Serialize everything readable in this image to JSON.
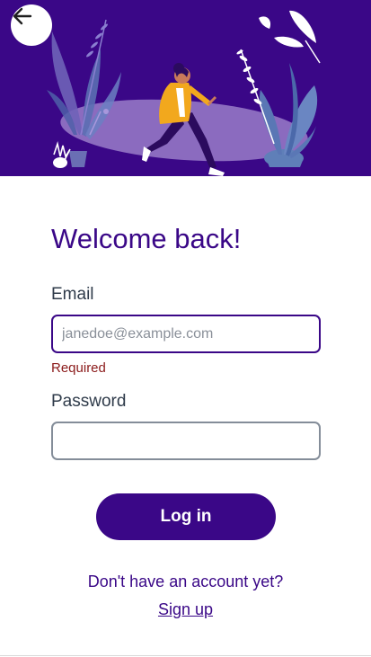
{
  "header": {
    "back_button_icon": "arrow-left-icon",
    "illustration": "woman-walking-with-plants-illustration",
    "background_color": "#3a0787"
  },
  "form": {
    "title": "Welcome back!",
    "email_label": "Email",
    "email_placeholder": "janedoe@example.com",
    "email_value": "",
    "email_error": "Required",
    "password_label": "Password",
    "password_value": "",
    "submit_label": "Log in"
  },
  "footer": {
    "prompt": "Don't have an account yet?",
    "signup_link": "Sign up"
  },
  "colors": {
    "accent": "#3a0787",
    "error": "#8b1a1a",
    "text": "#2f3b4a"
  }
}
